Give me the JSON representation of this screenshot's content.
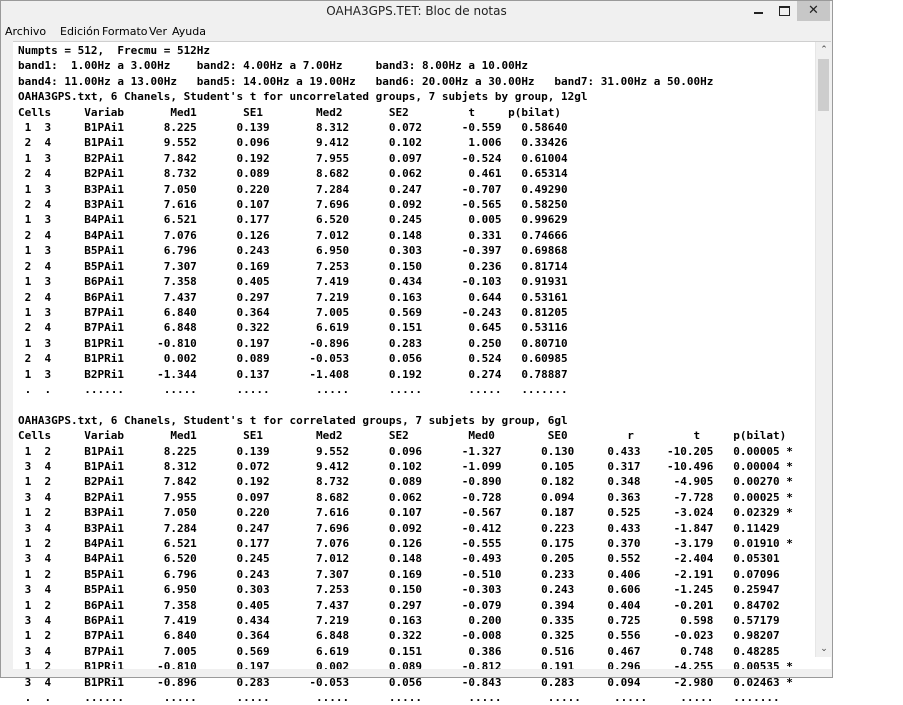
{
  "window": {
    "title": "OAHA3GPS.TET: Bloc de notas"
  },
  "menu": {
    "items": [
      "Archivo",
      "Edición",
      "Formato",
      "Ver",
      "Ayuda"
    ]
  },
  "editor": {
    "text": "Numpts = 512,  Frecmu = 512Hz\nband1:  1.00Hz a 3.00Hz    band2: 4.00Hz a 7.00Hz     band3: 8.00Hz a 10.00Hz\nband4: 11.00Hz a 13.00Hz   band5: 14.00Hz a 19.00Hz   band6: 20.00Hz a 30.00Hz   band7: 31.00Hz a 50.00Hz\nOAHA3GPS.txt, 6 Chanels, Student's t for uncorrelated groups, 7 subjets by group, 12gl\nCells     Variab       Med1       SE1        Med2       SE2         t     p(bilat)\n 1  3     B1PAi1      8.225      0.139       8.312      0.072      -0.559   0.58640\n 2  4     B1PAi1      9.552      0.096       9.412      0.102       1.006   0.33426\n 1  3     B2PAi1      7.842      0.192       7.955      0.097      -0.524   0.61004\n 2  4     B2PAi1      8.732      0.089       8.682      0.062       0.461   0.65314\n 1  3     B3PAi1      7.050      0.220       7.284      0.247      -0.707   0.49290\n 2  4     B3PAi1      7.616      0.107       7.696      0.092      -0.565   0.58250\n 1  3     B4PAi1      6.521      0.177       6.520      0.245       0.005   0.99629\n 2  4     B4PAi1      7.076      0.126       7.012      0.148       0.331   0.74666\n 1  3     B5PAi1      6.796      0.243       6.950      0.303      -0.397   0.69868\n 2  4     B5PAi1      7.307      0.169       7.253      0.150       0.236   0.81714\n 1  3     B6PAi1      7.358      0.405       7.419      0.434      -0.103   0.91931\n 2  4     B6PAi1      7.437      0.297       7.219      0.163       0.644   0.53161\n 1  3     B7PAi1      6.840      0.364       7.005      0.569      -0.243   0.81205\n 2  4     B7PAi1      6.848      0.322       6.619      0.151       0.645   0.53116\n 1  3     B1PRi1     -0.810      0.197      -0.896      0.283       0.250   0.80710\n 2  4     B1PRi1      0.002      0.089      -0.053      0.056       0.524   0.60985\n 1  3     B2PRi1     -1.344      0.137      -1.408      0.192       0.274   0.78887\n .  .     ......      .....      .....       .....      .....       .....   .......\n\nOAHA3GPS.txt, 6 Chanels, Student's t for correlated groups, 7 subjets by group, 6gl\nCells     Variab       Med1       SE1        Med2       SE2         Med0        SE0         r         t     p(bilat)\n 1  2     B1PAi1      8.225      0.139       9.552      0.096      -1.327      0.130     0.433    -10.205   0.00005 *\n 3  4     B1PAi1      8.312      0.072       9.412      0.102      -1.099      0.105     0.317    -10.496   0.00004 *\n 1  2     B2PAi1      7.842      0.192       8.732      0.089      -0.890      0.182     0.348     -4.905   0.00270 *\n 3  4     B2PAi1      7.955      0.097       8.682      0.062      -0.728      0.094     0.363     -7.728   0.00025 *\n 1  2     B3PAi1      7.050      0.220       7.616      0.107      -0.567      0.187     0.525     -3.024   0.02329 *\n 3  4     B3PAi1      7.284      0.247       7.696      0.092      -0.412      0.223     0.433     -1.847   0.11429\n 1  2     B4PAi1      6.521      0.177       7.076      0.126      -0.555      0.175     0.370     -3.179   0.01910 *\n 3  4     B4PAi1      6.520      0.245       7.012      0.148      -0.493      0.205     0.552     -2.404   0.05301\n 1  2     B5PAi1      6.796      0.243       7.307      0.169      -0.510      0.233     0.406     -2.191   0.07096\n 3  4     B5PAi1      6.950      0.303       7.253      0.150      -0.303      0.243     0.606     -1.245   0.25947\n 1  2     B6PAi1      7.358      0.405       7.437      0.297      -0.079      0.394     0.404     -0.201   0.84702\n 3  4     B6PAi1      7.419      0.434       7.219      0.163       0.200      0.335     0.725      0.598   0.57179\n 1  2     B7PAi1      6.840      0.364       6.848      0.322      -0.008      0.325     0.556     -0.023   0.98207\n 3  4     B7PAi1      7.005      0.569       6.619      0.151       0.386      0.516     0.467      0.748   0.48285\n 1  2     B1PRi1     -0.810      0.197       0.002      0.089      -0.812      0.191     0.296     -4.255   0.00535 *\n 3  4     B1PRi1     -0.896      0.283      -0.053      0.056      -0.843      0.283     0.094     -2.980   0.02463 *\n .  .     ......      .....      .....       .....      .....       .....       .....     .....     .....   ......."
  },
  "icons": {
    "minimize": "minimize-icon",
    "maximize": "maximize-icon",
    "close": "close-icon",
    "scroll_up": "chevron-up-icon",
    "scroll_down": "chevron-down-icon"
  }
}
